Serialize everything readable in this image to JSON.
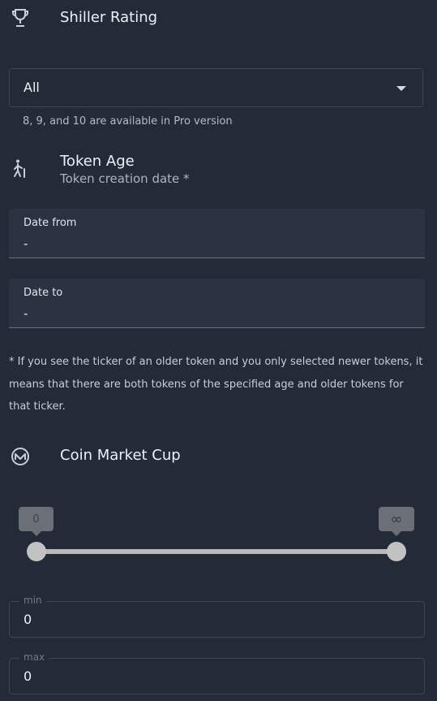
{
  "shiller": {
    "title": "Shiller Rating",
    "icon": "trophy-icon",
    "select_value": "All",
    "helper": "8, 9, and 10 are available in Pro version"
  },
  "token_age": {
    "title": "Token Age",
    "subtitle": "Token creation date *",
    "icon": "walking-elder-icon",
    "date_from": {
      "label": "Date from",
      "value": "-"
    },
    "date_to": {
      "label": "Date to",
      "value": "-"
    },
    "note": "* If you see the ticker of an older token and you only selected newer tokens, it means that there are both tokens of the specified age and older tokens for that ticker."
  },
  "market_cap": {
    "title": "Coin Market Cup",
    "icon": "coinmarketcap-icon",
    "slider": {
      "min_label": "0",
      "max_label": "∞",
      "low_fraction": 0,
      "high_fraction": 1
    },
    "min_field": {
      "legend": "min",
      "value": "0"
    },
    "max_field": {
      "legend": "max",
      "value": "0"
    }
  }
}
